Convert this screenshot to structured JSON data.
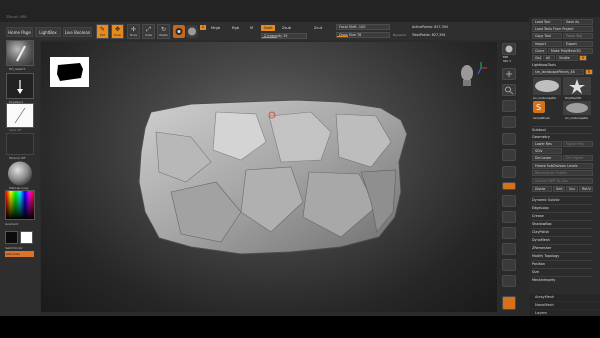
{
  "app": {
    "title": "ZBrush 4R8"
  },
  "nav": {
    "home": "Home Page",
    "lightbox": "LightBox",
    "live_boolean": "Live Boolean"
  },
  "tools": [
    {
      "label": "Edit",
      "glyph": "✎",
      "active": true
    },
    {
      "label": "Draw",
      "glyph": "✥",
      "active": true
    },
    {
      "label": "Move",
      "glyph": "✢",
      "active": false
    },
    {
      "label": "Scale",
      "glyph": "⤢",
      "active": false
    },
    {
      "label": "Rotate",
      "glyph": "↻",
      "active": false
    }
  ],
  "brush_settings": {
    "mode_a": "A",
    "mrgb": "Mrgb",
    "rgb": "Rgb",
    "m": "M",
    "zadd": "Zadd",
    "zsub": "Zsub",
    "zcut": "Zcut",
    "z_intensity": "Z Intensity 35",
    "z_intensity_value": 0.35,
    "focal_shift": "Focal Shift -100",
    "draw_size": "Draw Size 76",
    "dynamic": "Dynamic",
    "active_points": "ActivePoints: 827,394",
    "total_points": "TotalPoints: 827,394"
  },
  "left": {
    "brush_name": "DH_Slash3",
    "stroke_name": "DragRect",
    "alpha_name": "Alpha Off",
    "texture_name": "Texture Off",
    "material_name": "MatCap Gray",
    "gradient": "Gradient",
    "switch_color": "SwitchColor",
    "alternate": "Alternate"
  },
  "shelf": {
    "bpr": "BPR",
    "spix": "SPix 3",
    "scroll": "Scroll",
    "zoom": "Zoom",
    "actual": "Actual",
    "aahalf": "AAHalf",
    "persp": "Persp",
    "floor": "Floor",
    "local": "Local",
    "frame": "Frame",
    "move": "Move",
    "zoom3d": "ZoomD",
    "rotate": "Rotate",
    "line_fill": "Line Fill",
    "polyf": "PolyF",
    "transp": "Transp",
    "solo": "Solo",
    "xpose": "Xpose"
  },
  "right": {
    "load_tool": "Load Tool",
    "save_as": "Save As",
    "load_from_project": "Load Tools From Project",
    "copy_tool": "Copy Tool",
    "paste_tool": "Paste Tool",
    "import": "Import",
    "export": "Export",
    "clone": "Clone",
    "make_polymesh": "Make PolyMesh3D",
    "goz": "GoZ",
    "all": "All",
    "visible": "Visible",
    "r": "R",
    "lightbox_tools": "Lightbox▸Tools",
    "current_tool": "sm_landscapePieces_48",
    "tool_r": "R",
    "thumb_names": [
      "sm_landscapePie",
      "PolyMesh3D",
      "SimpleBrush",
      "sm_landscapePie"
    ],
    "subtool": "Subtool",
    "geometry": "Geometry",
    "lower_res": "Lower Res",
    "higher_res": "Higher Res",
    "sdiv": "SDiv",
    "del_lower": "Del Lower",
    "del_higher": "Del Higher",
    "freeze_subdiv": "Freeze SubDivision Levels",
    "reconstruct_subdiv": "Reconstruct Subdiv",
    "convert_bpr": "Convert BPR To Geo",
    "divide": "Divide",
    "smt": "Smt",
    "suv": "Suv",
    "reuv": "ReUV",
    "menu_items": [
      "Dynamic Subdiv",
      "EdgeLoop",
      "Crease",
      "ShadowBox",
      "ClayPolish",
      "DynaMesh",
      "ZRemesher",
      "Modify Topology",
      "Position",
      "Size",
      "MeshIntegrity"
    ],
    "array_mesh": "ArrayMesh",
    "nano_mesh": "NanoMesh",
    "layers": "Layers"
  }
}
